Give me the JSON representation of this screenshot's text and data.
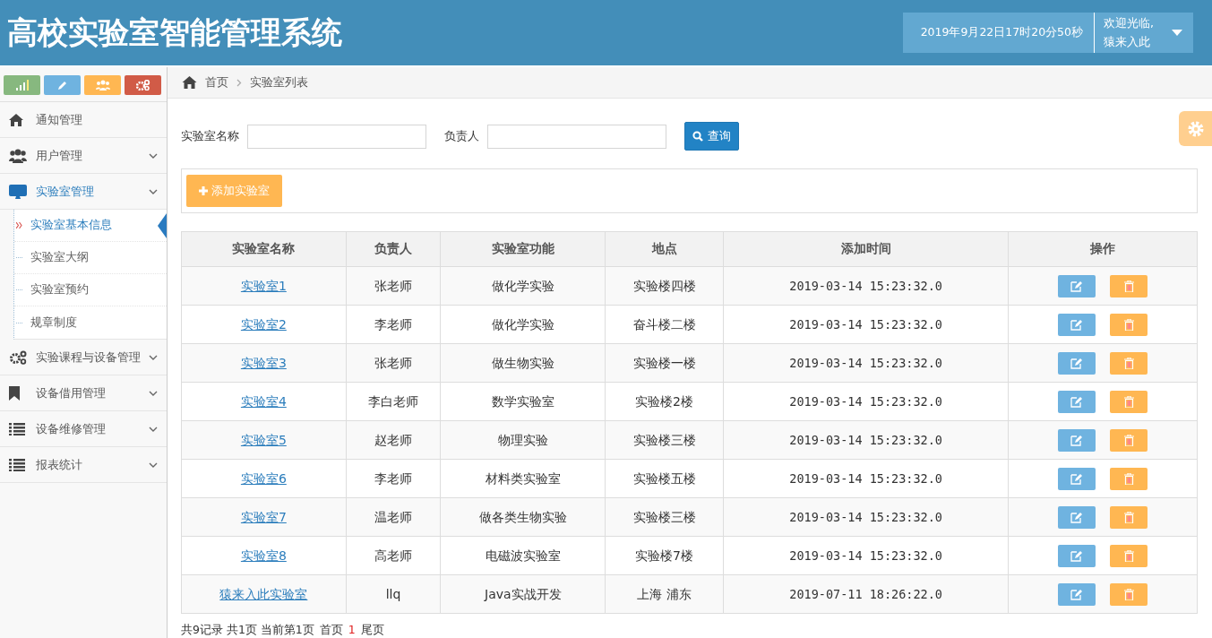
{
  "header": {
    "title": "高校实验室智能管理系统",
    "datetime": "2019年9月22日17时20分50秒",
    "welcome": "欢迎光临,",
    "user": "猿来入此"
  },
  "sidebar": {
    "items": [
      {
        "label": "通知管理",
        "expandable": false
      },
      {
        "label": "用户管理",
        "expandable": true
      },
      {
        "label": "实验室管理",
        "expandable": true,
        "expanded": true,
        "children": [
          {
            "label": "实验室基本信息",
            "selected": true
          },
          {
            "label": "实验室大纲",
            "selected": false
          },
          {
            "label": "实验室预约",
            "selected": false
          },
          {
            "label": "规章制度",
            "selected": false
          }
        ]
      },
      {
        "label": "实验课程与设备管理",
        "expandable": true
      },
      {
        "label": "设备借用管理",
        "expandable": true
      },
      {
        "label": "设备维修管理",
        "expandable": true
      },
      {
        "label": "报表统计",
        "expandable": true
      }
    ]
  },
  "breadcrumb": [
    "首页",
    "实验室列表"
  ],
  "search": {
    "fields": [
      {
        "label": "实验室名称"
      },
      {
        "label": "负责人"
      }
    ],
    "button": "查询"
  },
  "add_button": "添加实验室",
  "table": {
    "columns": [
      "实验室名称",
      "负责人",
      "实验室功能",
      "地点",
      "添加时间",
      "操作"
    ],
    "rows": [
      [
        "实验室1",
        "张老师",
        "做化学实验",
        "实验楼四楼",
        "2019-03-14 15:23:32.0"
      ],
      [
        "实验室2",
        "李老师",
        "做化学实验",
        "奋斗楼二楼",
        "2019-03-14 15:23:32.0"
      ],
      [
        "实验室3",
        "张老师",
        "做生物实验",
        "实验楼一楼",
        "2019-03-14 15:23:32.0"
      ],
      [
        "实验室4",
        "李白老师",
        "数学实验室",
        "实验楼2楼",
        "2019-03-14 15:23:32.0"
      ],
      [
        "实验室5",
        "赵老师",
        "物理实验",
        "实验楼三楼",
        "2019-03-14 15:23:32.0"
      ],
      [
        "实验室6",
        "李老师",
        "材料类实验室",
        "实验楼五楼",
        "2019-03-14 15:23:32.0"
      ],
      [
        "实验室7",
        "温老师",
        "做各类生物实验",
        "实验楼三楼",
        "2019-03-14 15:23:32.0"
      ],
      [
        "实验室8",
        "高老师",
        "电磁波实验室",
        "实验楼7楼",
        "2019-03-14 15:23:32.0"
      ],
      [
        "猿来入此实验室",
        "llq",
        "Java实战开发",
        "上海 浦东",
        "2019-07-11 18:26:22.0"
      ]
    ]
  },
  "pagination": {
    "summary": "共9记录 共1页 当前第1页",
    "first": "首页",
    "pages": [
      {
        "label": "1",
        "selected": true
      }
    ],
    "last": "尾页"
  }
}
